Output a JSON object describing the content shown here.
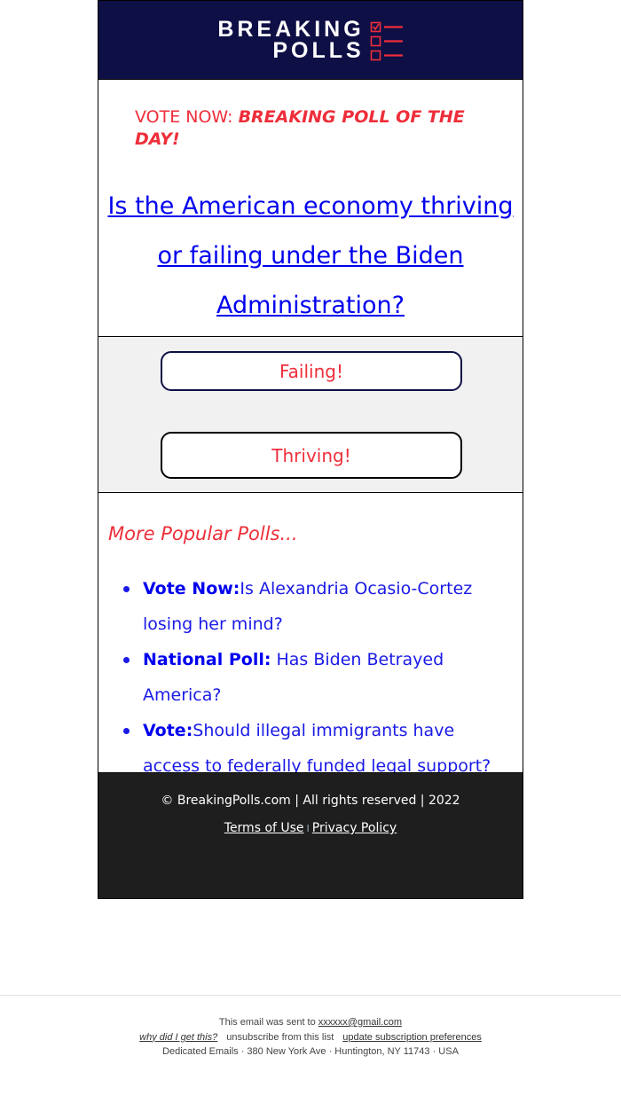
{
  "header": {
    "logo_line1": "BREAKING",
    "logo_line2": "POLLS",
    "brand_color": "#0e0f45",
    "accent_color": "#ee2e3a"
  },
  "banner": {
    "prefix": "VOTE NOW: ",
    "emphasis": "BREAKING POLL OF THE DAY!"
  },
  "question": {
    "text": "Is the American economy thriving or failing under the Biden Administration?"
  },
  "buttons": [
    {
      "label": "Failing!"
    },
    {
      "label": "Thriving!"
    }
  ],
  "more_polls": {
    "title": "More Popular Polls...",
    "items": [
      {
        "tag": "Vote Now:",
        "text": "Is Alexandria Ocasio-Cortez losing her mind?"
      },
      {
        "tag": "National Poll:",
        "text": " Has Biden Betrayed America?"
      },
      {
        "tag": "Vote:",
        "text": "Should illegal immigrants have access to federally funded legal support?"
      }
    ]
  },
  "footer": {
    "copyright": "© BreakingPolls.com | All rights reserved | 2022",
    "terms": "Terms of Use",
    "separator": "I",
    "privacy": "Privacy Policy"
  },
  "legal": {
    "sent_to_prefix": "This email was sent to ",
    "email": "xxxxxx@gmail.com",
    "why": "why did I get this?",
    "unsubscribe": "unsubscribe from this list",
    "preferences": "update subscription preferences",
    "address": "Dedicated Emails · 380 New York Ave · Huntington, NY 11743 · USA"
  }
}
